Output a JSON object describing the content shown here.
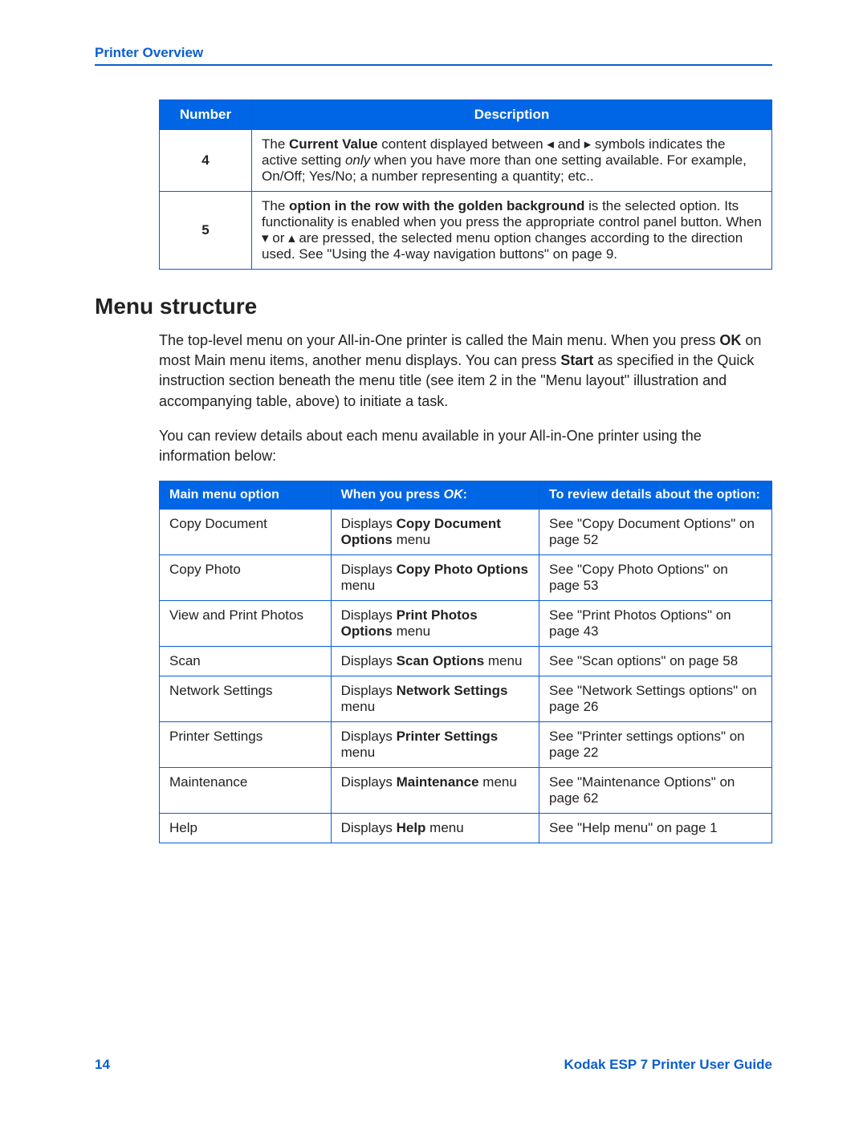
{
  "header": "Printer Overview",
  "table1": {
    "headers": {
      "num": "Number",
      "desc": "Description"
    },
    "rows": [
      {
        "num": "4",
        "desc_pre": "The ",
        "desc_b1": "Current Value",
        "desc_mid1": " content displayed between ◂ and ▸ symbols indicates the active setting ",
        "desc_i1": "only",
        "desc_post": " when you have more than one setting available. For example, On/Off; Yes/No; a number representing a quantity; etc.."
      },
      {
        "num": "5",
        "desc_pre": "The ",
        "desc_b1": "option in the row with the golden background",
        "desc_post": " is the selected option. Its functionality is enabled when you press the appropriate control panel button. When ▾ or ▴ are pressed, the selected menu option changes according to the direction used. See \"Using the 4-way navigation buttons\" on page 9."
      }
    ]
  },
  "section_title": "Menu structure",
  "para1": {
    "t1": "The top-level menu on your All-in-One printer is called the Main menu. When you press ",
    "b1": "OK",
    "t2": " on most Main menu items, another menu displays. You can press ",
    "b2": "Start",
    "t3": " as specified in the Quick instruction section beneath the menu title (see item 2 in the \"Menu layout\" illustration and accompanying table, above) to initiate a task."
  },
  "para2": "You can review details about each menu available in your All-in-One printer using the information below:",
  "table2": {
    "headers": {
      "c1": "Main menu option",
      "c2_pre": "When you press ",
      "c2_i": "OK",
      "c2_post": ":",
      "c3": "To review details about the option:"
    },
    "rows": [
      {
        "c1": "Copy Document",
        "c2_pre": "Displays ",
        "c2_b": "Copy Document Options",
        "c2_post": " menu",
        "c3": "See \"Copy Document Options\" on page 52"
      },
      {
        "c1": "Copy Photo",
        "c2_pre": "Displays ",
        "c2_b": "Copy Photo Options",
        "c2_post": " menu",
        "c3": "See \"Copy Photo Options\" on page 53"
      },
      {
        "c1": "View and Print Photos",
        "c2_pre": "Displays ",
        "c2_b": "Print Photos Options",
        "c2_post": " menu",
        "c3": "See \"Print Photos Options\" on page 43"
      },
      {
        "c1": "Scan",
        "c2_pre": "Displays ",
        "c2_b": "Scan Options",
        "c2_post": " menu",
        "c3": "See \"Scan options\" on page 58"
      },
      {
        "c1": "Network Settings",
        "c2_pre": "Displays ",
        "c2_b": "Network Settings",
        "c2_post": " menu",
        "c3": "See \"Network Settings options\" on page 26"
      },
      {
        "c1": "Printer Settings",
        "c2_pre": "Displays ",
        "c2_b": "Printer Settings",
        "c2_post": " menu",
        "c3": "See \"Printer settings options\" on page 22"
      },
      {
        "c1": "Maintenance",
        "c2_pre": "Displays ",
        "c2_b": "Maintenance",
        "c2_post": " menu",
        "c3": "See \"Maintenance Options\" on page 62"
      },
      {
        "c1": "Help",
        "c2_pre": "Displays ",
        "c2_b": "Help",
        "c2_post": " menu",
        "c3": "See \"Help menu\" on page 1"
      }
    ]
  },
  "footer": {
    "page": "14",
    "title": "Kodak ESP 7 Printer User Guide"
  }
}
